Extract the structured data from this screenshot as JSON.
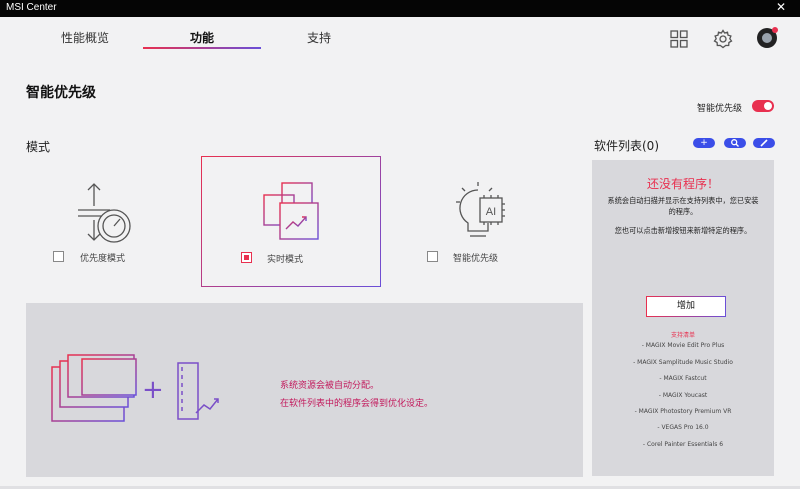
{
  "app": {
    "title": "MSI Center",
    "close_glyph": "✕"
  },
  "tabs": [
    {
      "label": "性能概览"
    },
    {
      "label": "功能"
    },
    {
      "label": "支持"
    }
  ],
  "header_icons": [
    "grid-icon",
    "gear-icon",
    "avatar"
  ],
  "page": {
    "title": "智能优先级",
    "toggle_label": "智能优先级",
    "toggle_on": true
  },
  "modes": {
    "section_label": "模式",
    "items": [
      {
        "label": "优先度模式",
        "checked": false
      },
      {
        "label": "实时模式",
        "checked": true
      },
      {
        "label": "智能优先级",
        "checked": false
      }
    ]
  },
  "info": {
    "line1": "系统资源会被自动分配。",
    "line2": "在软件列表中的程序会得到优化设定。",
    "plus": "+"
  },
  "software": {
    "title": "软件列表(0)",
    "add_pill": "+",
    "empty_title": "还没有程序！",
    "desc1": "系统会自动扫描并显示在支持列表中，您已安装的程序。",
    "desc2": "您也可以点击新增按钮来新增特定的程序。",
    "add_button": "增加",
    "supported_title": "支持清单",
    "supported": [
      "- MAGIX Movie Edit Pro Plus",
      "- MAGIX Samplitude Music Studio",
      "- MAGIX Fastcut",
      "- MAGIX Youcast",
      "- MAGIX Photostory Premium VR",
      "- VEGAS Pro 16.0",
      "- Corel Painter Essentials 6"
    ]
  },
  "colors": {
    "accent_red": "#e8304f",
    "accent_purple": "#6a4fd8",
    "blue": "#3b4ee8"
  }
}
